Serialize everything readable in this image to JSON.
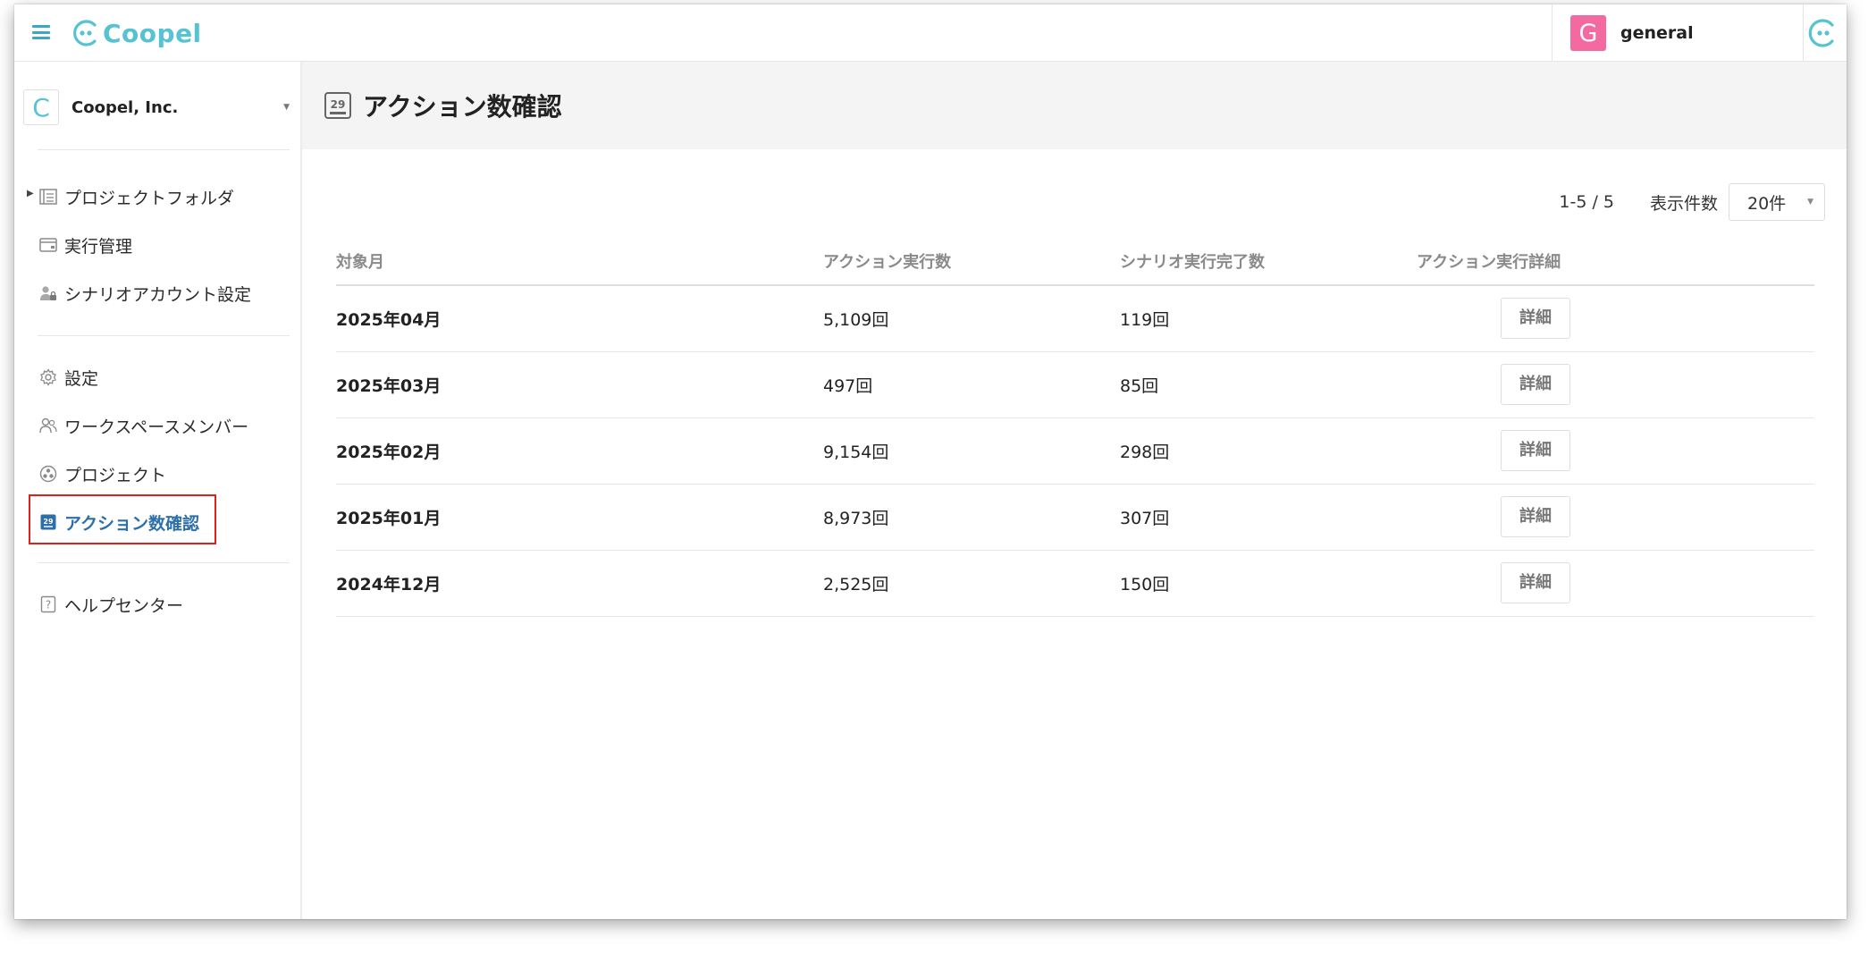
{
  "app": {
    "logo_text": "Coopel"
  },
  "user": {
    "initial": "G",
    "name": "general"
  },
  "colors": {
    "accent": "#57c2d2",
    "avatar": "#f26aa0",
    "active_nav": "#2d6fa8",
    "highlight": "#e0201b"
  },
  "sidebar": {
    "org_initial": "C",
    "org_name": "Coopel, Inc.",
    "items": [
      {
        "label": "プロジェクトフォルダ",
        "icon": "folder-list-icon"
      },
      {
        "label": "実行管理",
        "icon": "window-icon"
      },
      {
        "label": "シナリオアカウント設定",
        "icon": "user-lock-icon"
      },
      {
        "label": "設定",
        "icon": "gear-icon"
      },
      {
        "label": "ワークスペースメンバー",
        "icon": "members-icon"
      },
      {
        "label": "プロジェクト",
        "icon": "project-icon"
      },
      {
        "label": "アクション数確認",
        "icon": "calendar-icon",
        "active": true
      },
      {
        "label": "ヘルプセンター",
        "icon": "help-icon"
      }
    ]
  },
  "main": {
    "title": "アクション数確認",
    "pager": {
      "range": "1-5 / 5",
      "per_page_label": "表示件数",
      "per_page_value": "20件"
    },
    "table": {
      "headers": [
        "対象月",
        "アクション実行数",
        "シナリオ実行完了数",
        "アクション実行詳細"
      ],
      "rows": [
        {
          "month": "2025年04月",
          "actions": "5,109回",
          "completed": "119回",
          "detail": "詳細"
        },
        {
          "month": "2025年03月",
          "actions": "497回",
          "completed": "85回",
          "detail": "詳細"
        },
        {
          "month": "2025年02月",
          "actions": "9,154回",
          "completed": "298回",
          "detail": "詳細"
        },
        {
          "month": "2025年01月",
          "actions": "8,973回",
          "completed": "307回",
          "detail": "詳細"
        },
        {
          "month": "2024年12月",
          "actions": "2,525回",
          "completed": "150回",
          "detail": "詳細"
        }
      ]
    }
  }
}
